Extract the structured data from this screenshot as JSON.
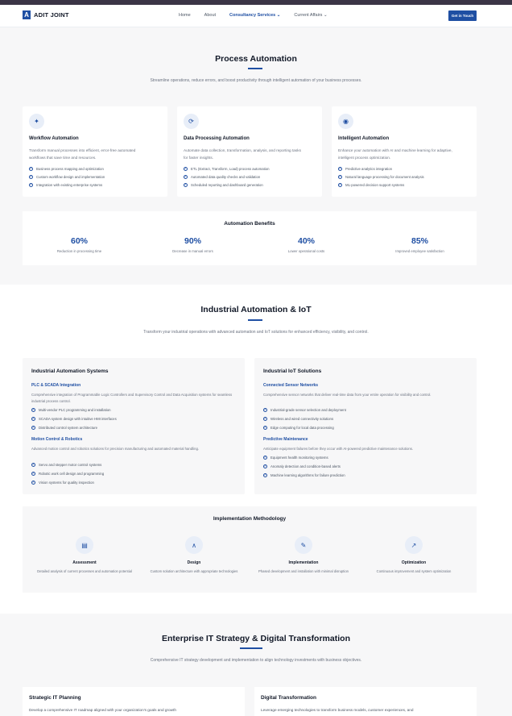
{
  "nav": {
    "brand": "ADIT JOINT",
    "logo_letter": "A",
    "links": [
      "Home",
      "About",
      "Consultancy Services",
      "Current Affairs"
    ],
    "cta": "Get in Touch"
  },
  "process": {
    "title": "Process Automation",
    "subtitle": "Streamline operations, reduce errors, and boost productivity through intelligent automation of your business processes.",
    "cards": [
      {
        "icon": "magic-wand-icon",
        "title": "Workflow Automation",
        "desc": "Transform manual processes into efficient, error-free automated workflows that save time and resources.",
        "features": [
          "Business process mapping and optimization",
          "Custom workflow design and implementation",
          "Integration with existing enterprise systems"
        ]
      },
      {
        "icon": "sync-icon",
        "title": "Data Processing Automation",
        "desc": "Automate data collection, transformation, analysis, and reporting tasks for faster insights.",
        "features": [
          "ETL (Extract, Transform, Load) process automation",
          "Automated data quality checks and validation",
          "Scheduled reporting and dashboard generation"
        ]
      },
      {
        "icon": "robot-icon",
        "title": "Intelligent Automation",
        "desc": "Enhance your automation with AI and machine learning for adaptive, intelligent process optimization.",
        "features": [
          "Predictive analytics integration",
          "Natural language processing for document analysis",
          "ML-powered decision support systems"
        ]
      }
    ],
    "benefits": {
      "title": "Automation Benefits",
      "stats": [
        {
          "value": "60%",
          "label": "Reduction in processing time"
        },
        {
          "value": "90%",
          "label": "Decrease in manual errors"
        },
        {
          "value": "40%",
          "label": "Lower operational costs"
        },
        {
          "value": "85%",
          "label": "Improved employee satisfaction"
        }
      ]
    }
  },
  "industrial": {
    "title": "Industrial Automation & IoT",
    "subtitle": "Transform your industrial operations with advanced automation and IoT solutions for enhanced efficiency, visibility, and control.",
    "panels": [
      {
        "title": "Industrial Automation Systems",
        "groups": [
          {
            "title": "PLC & SCADA Integration",
            "desc": "Comprehensive integration of Programmable Logic Controllers and Supervisory Control and Data Acquisition systems for seamless industrial process control.",
            "features": [
              "Multi-vendor PLC programming and installation",
              "SCADA system design with intuitive HMI interfaces",
              "Distributed control system architecture"
            ]
          },
          {
            "title": "Motion Control & Robotics",
            "desc": "Advanced motion control and robotics solutions for precision manufacturing and automated material handling.",
            "features": [
              "Servo and stepper motor control systems",
              "Robotic work cell design and programming",
              "Vision systems for quality inspection"
            ]
          }
        ]
      },
      {
        "title": "Industrial IoT Solutions",
        "groups": [
          {
            "title": "Connected Sensor Networks",
            "desc": "Comprehensive sensor networks that deliver real-time data from your entire operation for visibility and control.",
            "features": [
              "Industrial-grade sensor selection and deployment",
              "Wireless and wired connectivity solutions",
              "Edge computing for local data processing"
            ]
          },
          {
            "title": "Predictive Maintenance",
            "desc": "Anticipate equipment failures before they occur with AI-powered predictive maintenance solutions.",
            "features": [
              "Equipment health monitoring systems",
              "Anomaly detection and condition-based alerts",
              "Machine learning algorithms for failure prediction"
            ]
          }
        ]
      }
    ],
    "methodology": {
      "title": "Implementation Methodology",
      "steps": [
        {
          "icon": "clipboard-icon",
          "title": "Assessment",
          "desc": "Detailed analysis of current processes and automation potential"
        },
        {
          "icon": "compass-icon",
          "title": "Design",
          "desc": "Custom solution architecture with appropriate technologies"
        },
        {
          "icon": "wrench-icon",
          "title": "Implementation",
          "desc": "Phased development and installation with minimal disruption"
        },
        {
          "icon": "chart-line-icon",
          "title": "Optimization",
          "desc": "Continuous improvement and system optimization"
        }
      ]
    }
  },
  "enterprise": {
    "title": "Enterprise IT Strategy & Digital Transformation",
    "subtitle": "Comprehensive IT strategy development and implementation to align technology investments with business objectives.",
    "cards": [
      {
        "title": "Strategic IT Planning",
        "desc": "Develop a comprehensive IT roadmap aligned with your organization's goals and growth"
      },
      {
        "title": "Digital Transformation",
        "desc": "Leverage emerging technologies to transform business models, customer experiences, and"
      }
    ]
  }
}
